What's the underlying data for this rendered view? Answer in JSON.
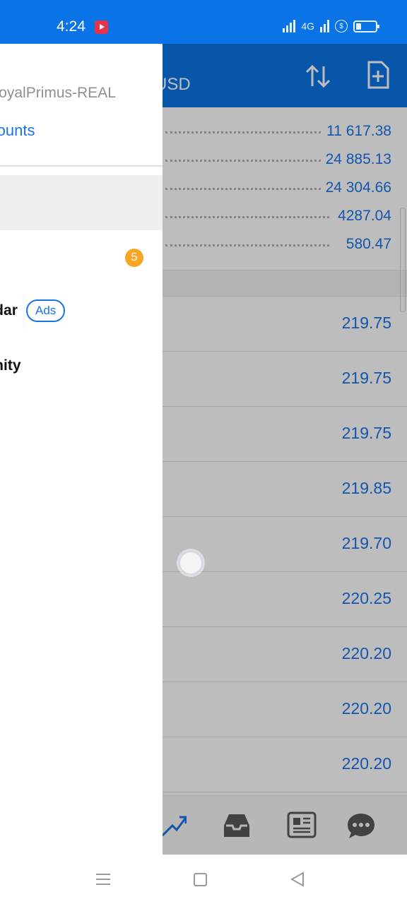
{
  "status_bar": {
    "time": "4:24",
    "network": "4G"
  },
  "header": {
    "currency": "USD"
  },
  "summary_values": [
    "11 617.38",
    "24 885.13",
    "24 304.66",
    "4287.04",
    "580.47"
  ],
  "price_rows": [
    "219.75",
    "219.75",
    "219.75",
    "219.85",
    "219.70",
    "220.25",
    "220.20",
    "220.20",
    "220.20"
  ],
  "drawer": {
    "server": "RoyalPrimus-REAL",
    "accounts_link": "Accounts",
    "badge_count": "5",
    "calendar_label": "Calendar",
    "ads_label": "Ads",
    "community_label": "Community"
  },
  "icons": {
    "sort": "sort-arrows-icon",
    "add": "add-document-icon",
    "trend": "trend-chart-icon",
    "inbox": "inbox-icon",
    "news": "news-icon",
    "chat": "chat-icon"
  },
  "colors": {
    "brand_blue": "#0a74e6",
    "value_blue": "#1a73e8",
    "badge_orange": "#f5a623"
  }
}
